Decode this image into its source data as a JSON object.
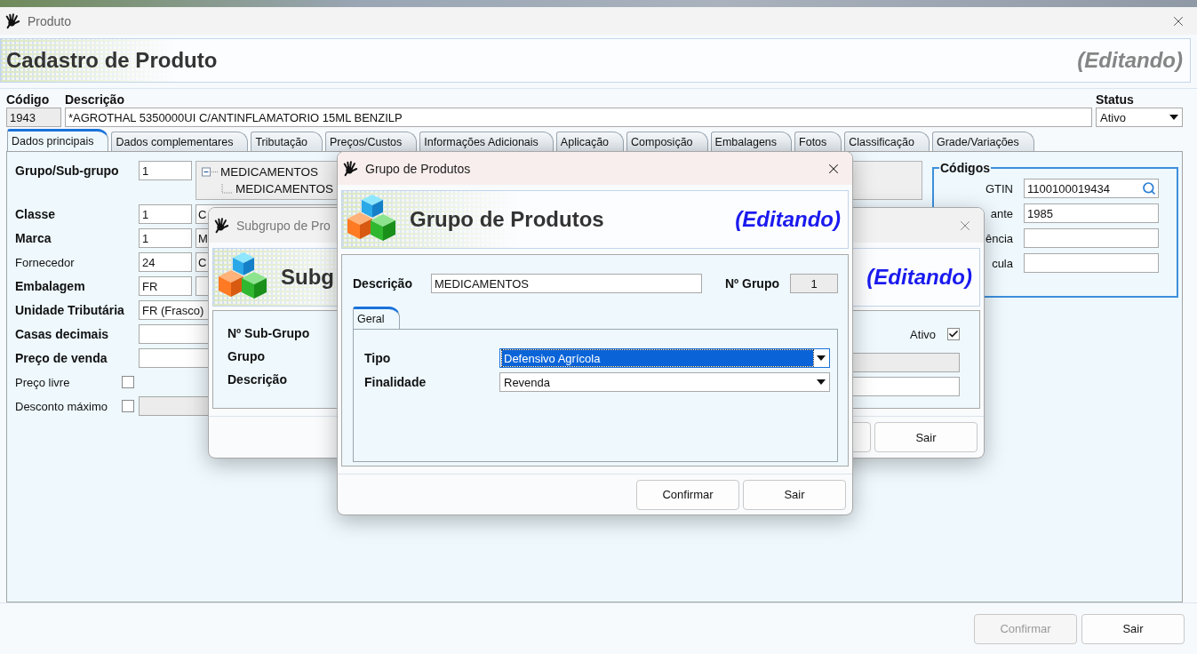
{
  "window": {
    "title": "Produto"
  },
  "header": {
    "title": "Cadastro de Produto",
    "status": "(Editando)"
  },
  "top_fields": {
    "codigo": {
      "label": "Código",
      "value": "1943"
    },
    "descricao": {
      "label": "Descrição",
      "value": "*AGROTHAL 5350000UI C/ANTINFLAMATORIO 15ML BENZILP"
    },
    "status": {
      "label": "Status",
      "value": "Ativo"
    }
  },
  "tabs": [
    {
      "label": "Dados principais",
      "selected": true
    },
    {
      "label": "Dados complementares",
      "selected": false
    },
    {
      "label": "Tributação",
      "selected": false
    },
    {
      "label": "Preços/Custos",
      "selected": false
    },
    {
      "label": "Informações Adicionais",
      "selected": false
    },
    {
      "label": "Aplicação",
      "selected": false
    },
    {
      "label": "Composição",
      "selected": false
    },
    {
      "label": "Embalagens",
      "selected": false
    },
    {
      "label": "Fotos",
      "selected": false
    },
    {
      "label": "Classificação",
      "selected": false
    },
    {
      "label": "Grade/Variações",
      "selected": false
    }
  ],
  "form_rows": [
    {
      "label": "Grupo/Sub-grupo",
      "bold": true,
      "kind": "tree",
      "code": "1",
      "tree": [
        {
          "label": "MEDICAMENTOS",
          "expanded": true,
          "children": [
            {
              "label": "MEDICAMENTOS"
            }
          ]
        }
      ]
    },
    {
      "label": "Classe",
      "bold": true,
      "kind": "code",
      "code": "1",
      "description": "C"
    },
    {
      "label": "Marca",
      "bold": true,
      "kind": "code",
      "code": "1",
      "description": "M"
    },
    {
      "label": "Fornecedor",
      "bold": false,
      "kind": "code",
      "code": "24",
      "description": "C"
    },
    {
      "label": "Embalagem",
      "bold": true,
      "kind": "code",
      "code": "FR"
    },
    {
      "label": "Unidade Tributária",
      "bold": true,
      "kind": "wide",
      "value": "FR (Frasco)"
    },
    {
      "label": "Casas decimais",
      "bold": true,
      "kind": "wide"
    },
    {
      "label": "Preço de venda",
      "bold": true,
      "kind": "wide"
    },
    {
      "label": "Preço livre",
      "bold": false,
      "kind": "checkbox",
      "checked": false
    },
    {
      "label": "Desconto máximo",
      "bold": false,
      "kind": "checkbox",
      "checked": false,
      "input": {
        "disabled": true
      }
    }
  ],
  "codigos": {
    "title": "Códigos",
    "rows": [
      {
        "label": "GTIN",
        "value": "1100100019434",
        "search": true
      },
      {
        "label": "ante",
        "value": "1985",
        "search": false
      },
      {
        "label": "ência",
        "search": false
      },
      {
        "label": "cula",
        "search": false
      }
    ]
  },
  "footer_buttons": [
    {
      "label": "Confirmar",
      "disabled": true
    },
    {
      "label": "Sair",
      "disabled": false
    }
  ],
  "subgroup_dialog": {
    "title": "Subgrupo de Pro",
    "header": {
      "title": "Subg",
      "status": "(Editando)"
    },
    "labels": [
      "Nº Sub-Grupo",
      "Grupo",
      "Descrição"
    ],
    "ativo": {
      "label": "Ativo",
      "checked": true
    },
    "fields": [
      {
        "disabled": true
      },
      {
        "disabled": false
      }
    ],
    "buttons": [
      {
        "label": "Sair",
        "disabled": false
      }
    ]
  },
  "group_dialog": {
    "title": "Grupo de Produtos",
    "header": {
      "title": "Grupo de Produtos",
      "status": "(Editando)"
    },
    "descricao": {
      "label": "Descrição",
      "value": "MEDICAMENTOS"
    },
    "numero": {
      "label": "Nº Grupo",
      "value": "1"
    },
    "tabs": [
      {
        "label": "Geral",
        "selected": true
      }
    ],
    "selects": [
      {
        "label": "Tipo",
        "value": "Defensivo Agrícola",
        "focused": true
      },
      {
        "label": "Finalidade",
        "value": "Revenda",
        "focused": false
      }
    ],
    "buttons": [
      {
        "label": "Confirmar",
        "disabled": false
      },
      {
        "label": "Sair",
        "disabled": false
      }
    ]
  }
}
